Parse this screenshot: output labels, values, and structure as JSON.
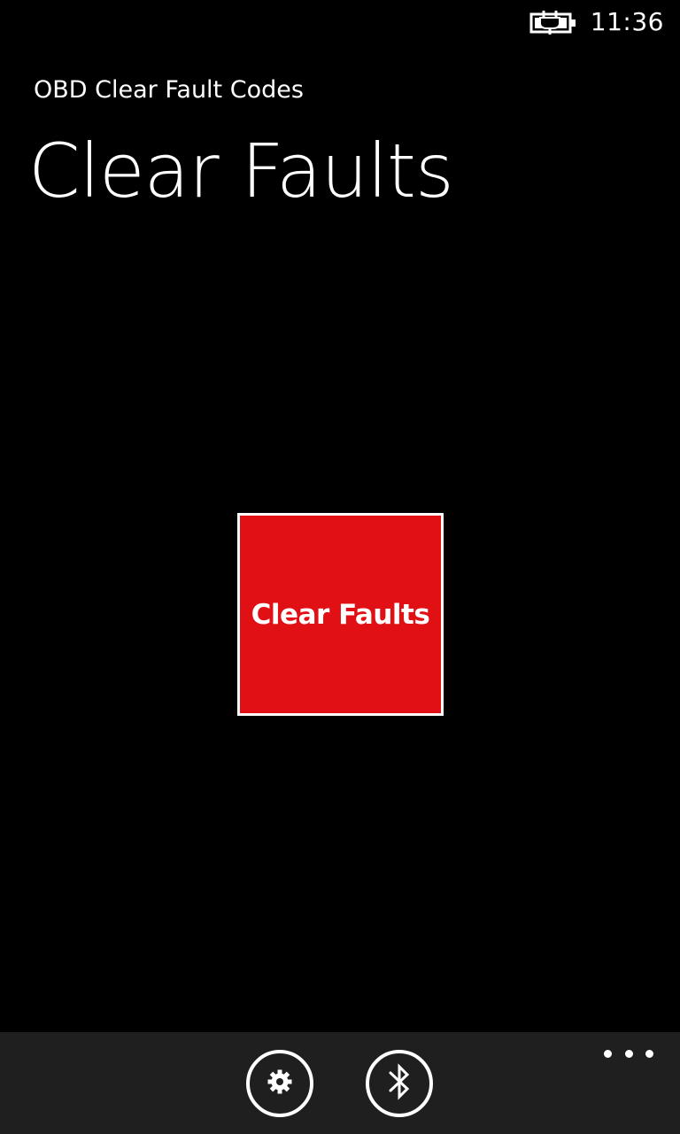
{
  "status_bar": {
    "time": "11:36",
    "battery_icon": "battery-charging-icon"
  },
  "header": {
    "app_title": "OBD Clear Fault Codes",
    "page_title": "Clear Faults"
  },
  "main": {
    "clear_button_label": "Clear Faults"
  },
  "app_bar": {
    "buttons": [
      {
        "icon": "gear-icon"
      },
      {
        "icon": "bluetooth-icon"
      }
    ],
    "more_icon": "ellipsis-icon"
  },
  "colors": {
    "background": "#000000",
    "accent": "#e01015",
    "app_bar": "#1f1f1f",
    "foreground": "#ffffff"
  }
}
